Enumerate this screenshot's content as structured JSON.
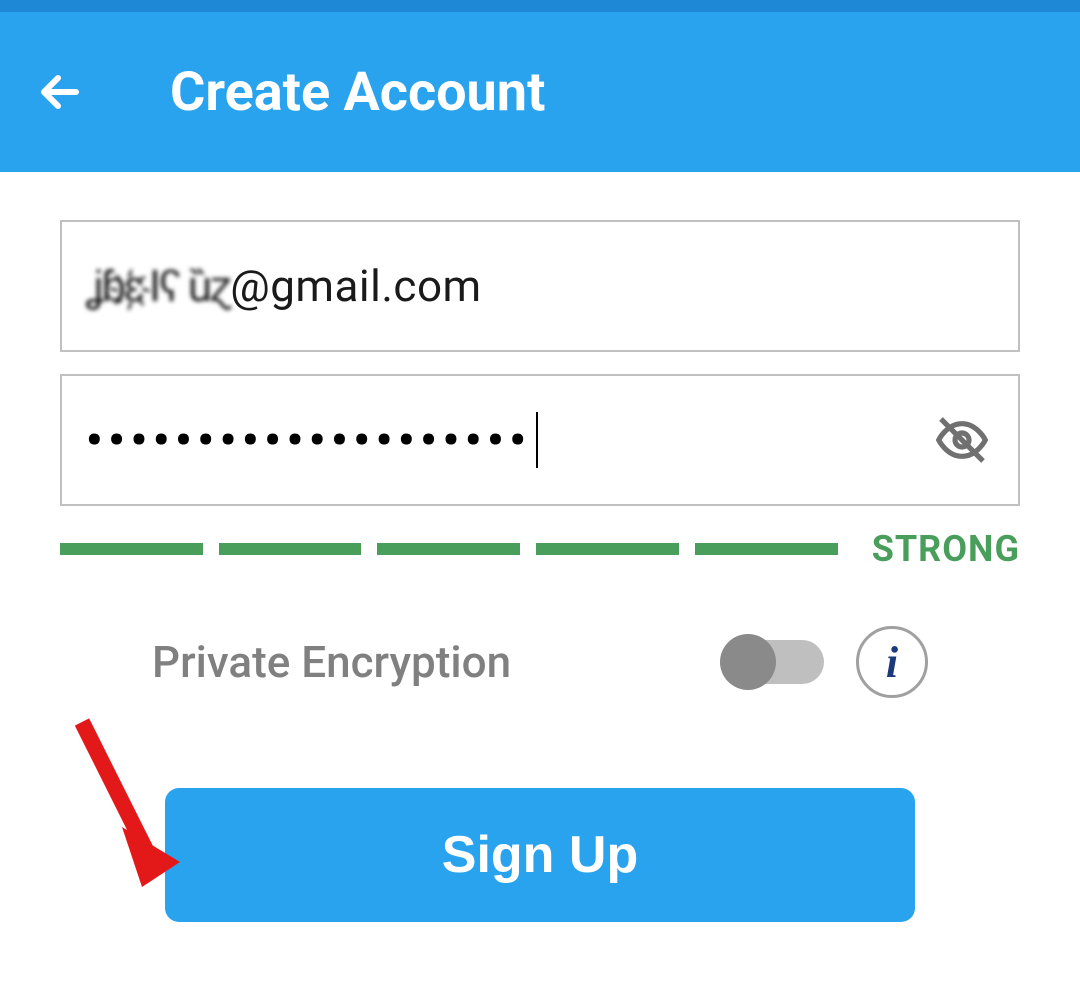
{
  "header": {
    "title": "Create Account"
  },
  "form": {
    "email_prefix_obscured": "ʝɓɛ҉ ӏʕ ȕɀ",
    "email_suffix": "@gmail.com",
    "password_masked": "••••••••••••••••••••",
    "strength_label": "STRONG",
    "strength_bars": 5
  },
  "encryption": {
    "label": "Private Encryption",
    "enabled": false
  },
  "signup": {
    "label": "Sign Up"
  },
  "icons": {
    "info_glyph": "i"
  }
}
